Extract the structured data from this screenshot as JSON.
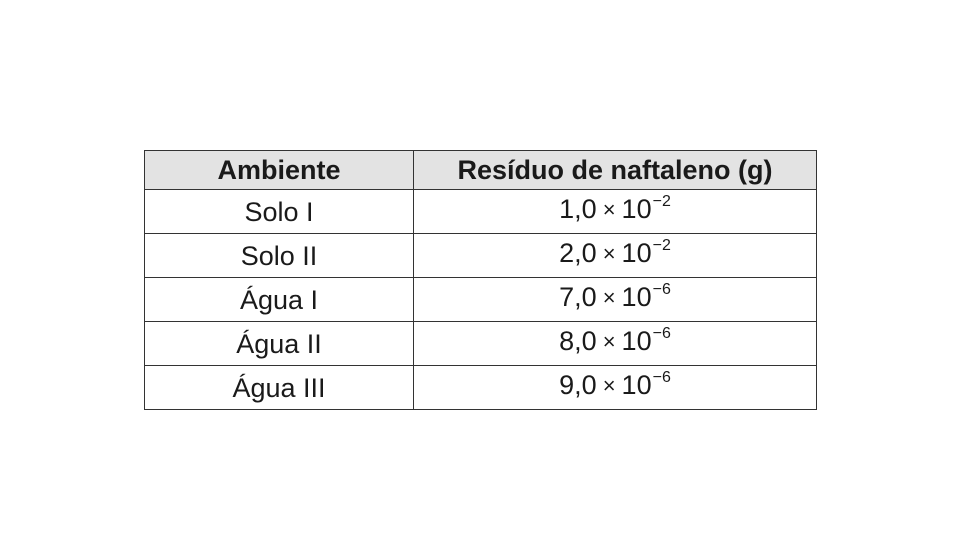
{
  "table": {
    "headers": [
      "Ambiente",
      "Resíduo de naftaleno (g)"
    ],
    "rows": [
      {
        "ambiente": "Solo I",
        "mantissa": "1,0",
        "times": "×",
        "base": "10",
        "exponent": "−2"
      },
      {
        "ambiente": "Solo II",
        "mantissa": "2,0",
        "times": "×",
        "base": "10",
        "exponent": "−2"
      },
      {
        "ambiente": "Água I",
        "mantissa": "7,0",
        "times": "×",
        "base": "10",
        "exponent": "−6"
      },
      {
        "ambiente": "Água II",
        "mantissa": "8,0",
        "times": "×",
        "base": "10",
        "exponent": "−6"
      },
      {
        "ambiente": "Água III",
        "mantissa": "9,0",
        "times": "×",
        "base": "10",
        "exponent": "−6"
      }
    ]
  }
}
